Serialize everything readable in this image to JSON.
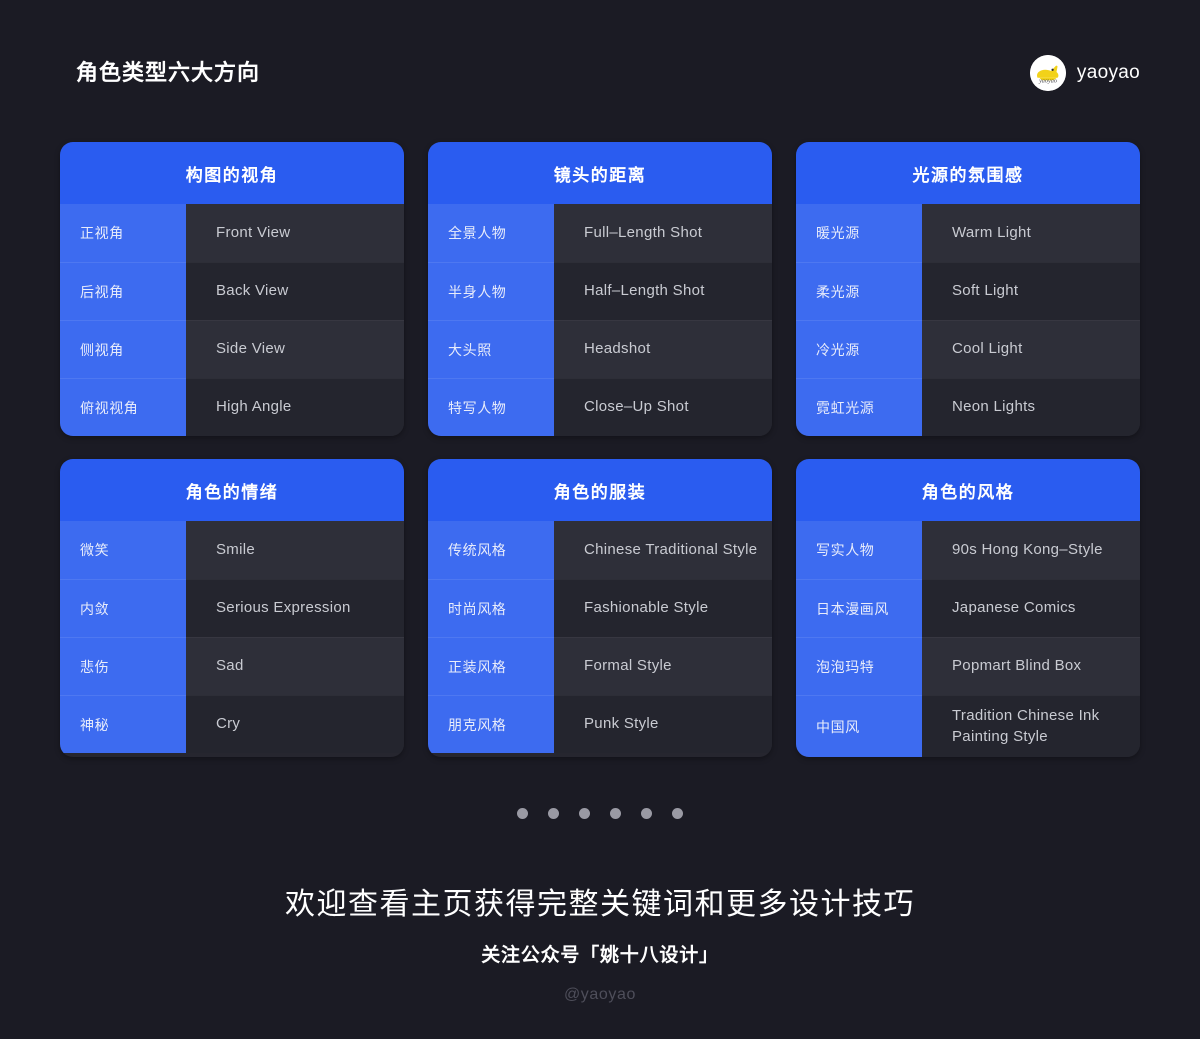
{
  "header": {
    "title": "角色类型六大方向",
    "brand_name": "yaoyao",
    "brand_icon": "yaoyao-rabbit-logo",
    "brand_mark_bg": "#ffffff",
    "brand_mark_fg": "#f2d21a"
  },
  "theme": {
    "page_bg": "#1b1b24",
    "accent_header": "#2a5cf0",
    "accent_column": "#3d6bf0",
    "row_light": "#2e2f39",
    "row_dark": "#24252e",
    "text_primary": "#ffffff",
    "text_en": "#c9cbd2",
    "dot_color": "#9a9aa4"
  },
  "cards": [
    {
      "title": "构图的视角",
      "rows": [
        {
          "cn": "正视角",
          "en": "Front View"
        },
        {
          "cn": "后视角",
          "en": "Back View"
        },
        {
          "cn": "侧视角",
          "en": "Side View"
        },
        {
          "cn": "俯视视角",
          "en": "High Angle"
        }
      ]
    },
    {
      "title": "镜头的距离",
      "rows": [
        {
          "cn": "全景人物",
          "en": "Full–Length Shot"
        },
        {
          "cn": "半身人物",
          "en": "Half–Length Shot"
        },
        {
          "cn": "大头照",
          "en": "Headshot"
        },
        {
          "cn": "特写人物",
          "en": "Close–Up Shot"
        }
      ]
    },
    {
      "title": "光源的氛围感",
      "rows": [
        {
          "cn": "暖光源",
          "en": "Warm Light"
        },
        {
          "cn": "柔光源",
          "en": "Soft Light"
        },
        {
          "cn": "冷光源",
          "en": "Cool Light"
        },
        {
          "cn": "霓虹光源",
          "en": "Neon Lights"
        }
      ]
    },
    {
      "title": "角色的情绪",
      "rows": [
        {
          "cn": "微笑",
          "en": "Smile"
        },
        {
          "cn": "内敛",
          "en": "Serious Expression"
        },
        {
          "cn": "悲伤",
          "en": "Sad"
        },
        {
          "cn": "神秘",
          "en": "Cry"
        }
      ]
    },
    {
      "title": "角色的服装",
      "rows": [
        {
          "cn": "传统风格",
          "en": "Chinese Traditional Style"
        },
        {
          "cn": "时尚风格",
          "en": "Fashionable Style"
        },
        {
          "cn": "正装风格",
          "en": "Formal Style"
        },
        {
          "cn": "朋克风格",
          "en": "Punk Style"
        }
      ]
    },
    {
      "title": "角色的风格",
      "rows": [
        {
          "cn": "写实人物",
          "en": "90s Hong Kong–Style"
        },
        {
          "cn": "日本漫画风",
          "en": "Japanese Comics"
        },
        {
          "cn": "泡泡玛特",
          "en": "Popmart Blind Box"
        },
        {
          "cn": "中国风",
          "en": "Tradition Chinese Ink Painting Style"
        }
      ]
    }
  ],
  "pagination": {
    "total": 6,
    "dots": [
      "1",
      "2",
      "3",
      "4",
      "5",
      "6"
    ]
  },
  "footer": {
    "headline": "欢迎查看主页获得完整关键词和更多设计技巧",
    "subline": "关注公众号「姚十八设计」",
    "handle": "@yaoyao"
  }
}
